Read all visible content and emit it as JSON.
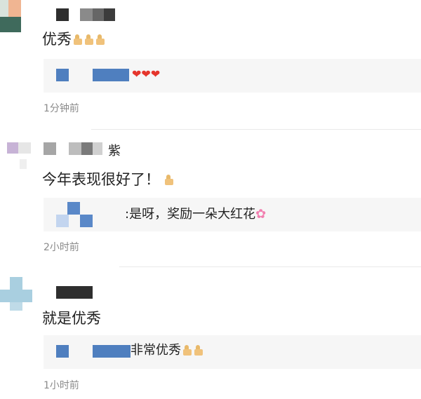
{
  "comments": [
    {
      "name_suffix": "",
      "text": "优秀",
      "emoji": "thumbs-up",
      "reply": {
        "text": "",
        "emoji": "hearts"
      },
      "time": "1分钟前"
    },
    {
      "name_suffix": "紫",
      "text": "今年表现很好了！",
      "emoji": "thumbs-up",
      "reply": {
        "text": ":是呀，奖励一朵大红花",
        "emoji": "flower"
      },
      "time": "2小时前"
    },
    {
      "name_suffix": "",
      "text": "就是优秀",
      "emoji": "",
      "reply": {
        "text": "非常优秀",
        "emoji": "thumbs-up"
      },
      "time": "1小时前"
    }
  ]
}
